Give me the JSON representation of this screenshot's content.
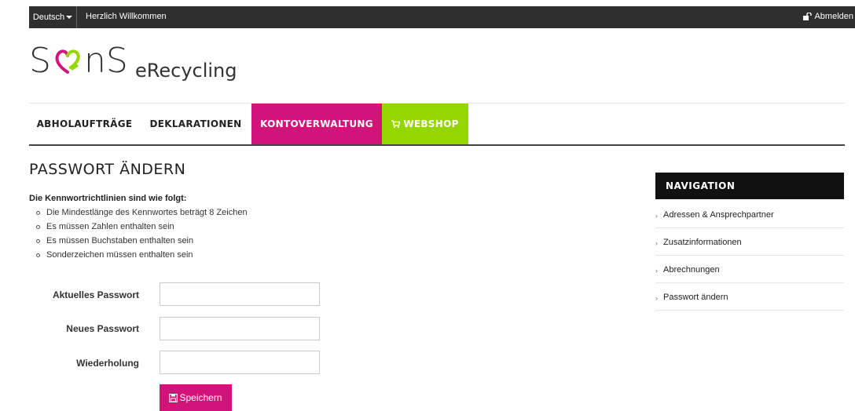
{
  "topbar": {
    "language": "Deutsch",
    "welcome": "Herzlich Willkommen",
    "logout": "Abmelden"
  },
  "logo": {
    "brand": "S",
    "brand_end": "nS",
    "sub": "eRecycling",
    "colors": {
      "pink": "#d2147a",
      "green": "#95d600",
      "text": "#333333"
    }
  },
  "nav": {
    "items": [
      {
        "label": "ABHOLAUFTRÄGE"
      },
      {
        "label": "DEKLARATIONEN"
      },
      {
        "label": "KONTOVERWALTUNG",
        "active": true,
        "color": "#d2147a"
      },
      {
        "label": "WEBSHOP",
        "icon": "cart-icon",
        "color": "#95d600"
      }
    ]
  },
  "page": {
    "title": "PASSWORT ÄNDERN",
    "rules_title": "Die Kennwortrichtlinien sind wie folgt:",
    "rules": [
      "Die Mindestlänge des Kennwortes beträgt 8 Zeichen",
      "Es müssen Zahlen enthalten sein",
      "Es müssen Buchstaben enthalten sein",
      "Sonderzeichen müssen enthalten sein"
    ]
  },
  "form": {
    "current_label": "Aktuelles Passwort",
    "new_label": "Neues Passwort",
    "repeat_label": "Wiederholung",
    "current_value": "",
    "new_value": "",
    "repeat_value": "",
    "save_label": "Speichern"
  },
  "sidebar": {
    "title": "NAVIGATION",
    "items": [
      {
        "label": "Adressen & Ansprechpartner"
      },
      {
        "label": "Zusatzinformationen"
      },
      {
        "label": "Abrechnungen"
      },
      {
        "label": "Passwort ändern"
      }
    ]
  }
}
